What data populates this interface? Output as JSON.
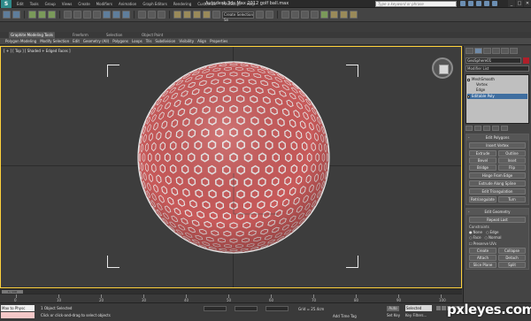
{
  "window": {
    "title": "Autodesk 3ds Max 2012    golf ball.max",
    "search_placeholder": "Type a keyword or phrase",
    "controls": [
      "_",
      "□",
      "✕"
    ]
  },
  "menu": [
    "Edit",
    "Tools",
    "Group",
    "Views",
    "Create",
    "Modifiers",
    "Animation",
    "Graph Editors",
    "Rendering",
    "Customize",
    "MAXScript",
    "Help"
  ],
  "toolbar": {
    "selection_set_placeholder": "Create Selection Se"
  },
  "ribbon": {
    "tabs": [
      "Graphite Modeling Tools",
      "Freeform",
      "Selection",
      "Object Paint"
    ],
    "items": [
      "Polygon Modeling",
      "Modify Selection",
      "Edit",
      "Geometry (All)",
      "Polygons",
      "Loops",
      "Tris",
      "Subdivision",
      "Visibility",
      "Align",
      "Properties"
    ]
  },
  "viewport": {
    "label": "[ + ] [ Top ] [ Shaded + Edged Faces ]",
    "sphere_color": "#c85a5a",
    "hex_cell_color": "#e8e8e8"
  },
  "command_panel": {
    "object_name": "GeoSphere01",
    "object_color": "#b01f2a",
    "modifier_list": "Modifier List",
    "stack": [
      "MeshSmooth",
      "Vertex",
      "Edge",
      "Editable Poly"
    ],
    "edit_polygons": {
      "title": "Edit Polygons",
      "insert_vertex": "Insert Vertex",
      "extrude": "Extrude",
      "outline": "Outline",
      "bevel": "Bevel",
      "inset": "Inset",
      "bridge": "Bridge",
      "flip": "Flip",
      "hinge_from_edge": "Hinge From Edge",
      "extrude_along_spline": "Extrude Along Spline",
      "edit_triangulation": "Edit Triangulation",
      "retriangulate": "Retriangulate",
      "turn": "Turn"
    },
    "edit_geometry": {
      "title": "Edit Geometry",
      "repeat_last": "Repeat Last",
      "constraints_label": "Constraints",
      "constraints": [
        "None",
        "Edge",
        "Face",
        "Normal"
      ],
      "preserve_uvs": "Preserve UVs",
      "create": "Create",
      "collapse": "Collapse",
      "attach": "Attach",
      "detach": "Detach",
      "slice_plane": "Slice Plane",
      "split": "Split"
    }
  },
  "timeline": {
    "frame": "0 / 100",
    "ticks": [
      "0",
      "10",
      "20",
      "30",
      "40",
      "50",
      "60",
      "70",
      "80",
      "90",
      "100"
    ]
  },
  "status": {
    "maxscript": "Max to Physc",
    "selection": "1 Object Selected",
    "prompt": "Click or click-and-drag to select objects",
    "grid": "Grid = 25.4cm",
    "add_time_tag": "Add Time Tag",
    "auto_key": "Auto",
    "selected": "Selected",
    "set_key": "Set Key",
    "key_filters": "Key Filters..."
  },
  "watermark": "pxleyes.com"
}
